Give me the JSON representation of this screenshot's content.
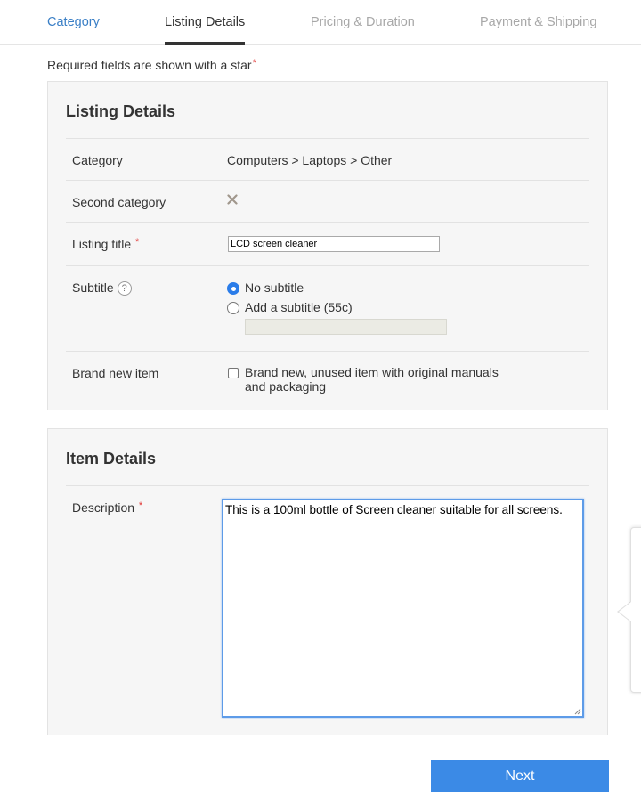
{
  "tabs": {
    "category": "Category",
    "listing_details": "Listing Details",
    "pricing_duration": "Pricing & Duration",
    "payment_shipping": "Payment & Shipping"
  },
  "required_note": {
    "text": "Required fields are shown with a star",
    "star": "*"
  },
  "listing_details": {
    "title": "Listing Details",
    "category_label": "Category",
    "category_value": "Computers > Laptops > Other",
    "second_category_label": "Second category",
    "listing_title_label": "Listing title",
    "listing_title_value": "LCD screen cleaner",
    "subtitle_label": "Subtitle",
    "subtitle_help": "?",
    "subtitle_options": [
      "No subtitle",
      "Add a subtitle (55c)"
    ],
    "subtitle_selected": "No subtitle",
    "brand_new_label": "Brand new item",
    "brand_new_checkbox_label": "Brand new, unused item with original manuals and packaging",
    "brand_new_checked": false
  },
  "item_details": {
    "title": "Item Details",
    "description_label": "Description",
    "description_value": "This is a 100ml bottle of Screen cleaner suitable for all screens."
  },
  "actions": {
    "next_label": "Next"
  },
  "colors": {
    "link_blue": "#3a7fc6",
    "primary_button": "#3b8ae6",
    "required_star": "#e0312f",
    "focus_border": "#5d9be8"
  }
}
